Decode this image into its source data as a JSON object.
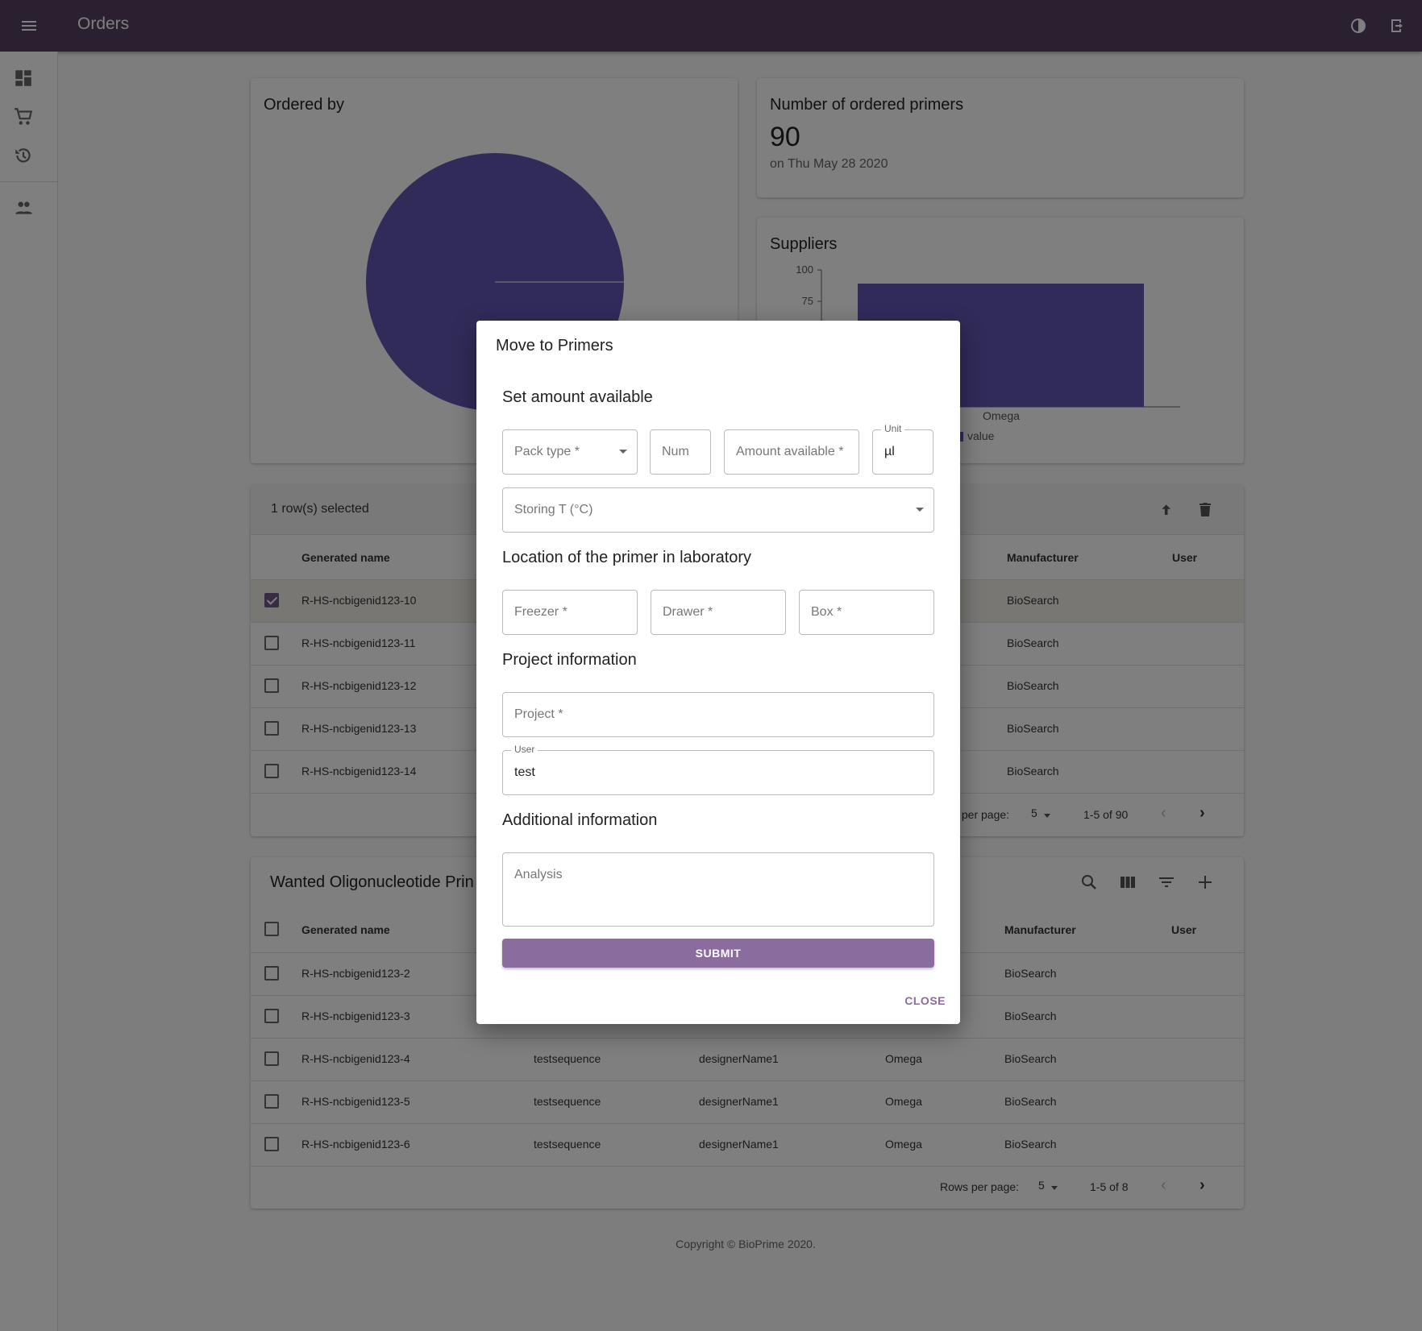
{
  "appbar": {
    "title": "Orders",
    "menu_icon": "menu-icon",
    "theme_icon": "contrast-icon",
    "logout_icon": "logout-icon"
  },
  "sidebar": {
    "items": [
      "dashboard-icon",
      "cart-icon",
      "history-icon",
      "users-icon"
    ]
  },
  "ordered_by": {
    "title": "Ordered by"
  },
  "primers_count": {
    "title": "Number of ordered primers",
    "value": "90",
    "date": "on Thu May 28 2020"
  },
  "suppliers": {
    "title": "Suppliers",
    "legend": "value"
  },
  "chart_data": [
    {
      "type": "pie",
      "title": "Ordered by",
      "values": [
        90
      ]
    },
    {
      "type": "bar",
      "title": "Suppliers",
      "categories": [
        "Omega"
      ],
      "series": [
        {
          "name": "value",
          "values": [
            90
          ]
        }
      ],
      "yticks": [
        "100",
        "75"
      ],
      "ylim": [
        0,
        100
      ]
    }
  ],
  "orders_table": {
    "selected_text": "1 row(s) selected",
    "headers": {
      "name": "Generated name",
      "manufacturer": "Manufacturer",
      "user": "User"
    },
    "rows": [
      {
        "name": "R-HS-ncbigenid123-10",
        "manufacturer": "BioSearch",
        "checked": true
      },
      {
        "name": "R-HS-ncbigenid123-11",
        "manufacturer": "BioSearch",
        "checked": false
      },
      {
        "name": "R-HS-ncbigenid123-12",
        "manufacturer": "BioSearch",
        "checked": false
      },
      {
        "name": "R-HS-ncbigenid123-13",
        "manufacturer": "BioSearch",
        "checked": false
      },
      {
        "name": "R-HS-ncbigenid123-14",
        "manufacturer": "BioSearch",
        "checked": false
      }
    ],
    "footer": {
      "rows_label": "s per page:",
      "rows_value": "5",
      "range": "1-5 of 90"
    }
  },
  "wanted_table": {
    "title": "Wanted Oligonucleotide Prin",
    "headers": {
      "name": "Generated name",
      "manufacturer": "Manufacturer",
      "user": "User"
    },
    "rows": [
      {
        "name": "R-HS-ncbigenid123-2",
        "sequence": "",
        "designer": "",
        "supplier": "",
        "manufacturer": "BioSearch"
      },
      {
        "name": "R-HS-ncbigenid123-3",
        "sequence": "",
        "designer": "",
        "supplier": "",
        "manufacturer": "BioSearch"
      },
      {
        "name": "R-HS-ncbigenid123-4",
        "sequence": "testsequence",
        "designer": "designerName1",
        "supplier": "Omega",
        "manufacturer": "BioSearch"
      },
      {
        "name": "R-HS-ncbigenid123-5",
        "sequence": "testsequence",
        "designer": "designerName1",
        "supplier": "Omega",
        "manufacturer": "BioSearch"
      },
      {
        "name": "R-HS-ncbigenid123-6",
        "sequence": "testsequence",
        "designer": "designerName1",
        "supplier": "Omega",
        "manufacturer": "BioSearch"
      }
    ],
    "footer": {
      "rows_label": "Rows per page:",
      "rows_value": "5",
      "range": "1-5 of 8"
    }
  },
  "copyright": "Copyright © BioPrime 2020.",
  "dialog": {
    "title": "Move to Primers",
    "sections": {
      "amount": "Set amount available",
      "location": "Location of the primer in laboratory",
      "project": "Project information",
      "additional": "Additional information"
    },
    "fields": {
      "pack_type": "Pack type *",
      "num": "Num",
      "amount_available": "Amount available *",
      "unit_label": "Unit",
      "unit_value": "µl",
      "storing_t": "Storing T (°C)",
      "freezer": "Freezer *",
      "drawer": "Drawer *",
      "box": "Box *",
      "project": "Project *",
      "user_label": "User",
      "user_value": "test",
      "analysis": "Analysis"
    },
    "submit": "SUBMIT",
    "close": "CLOSE"
  }
}
